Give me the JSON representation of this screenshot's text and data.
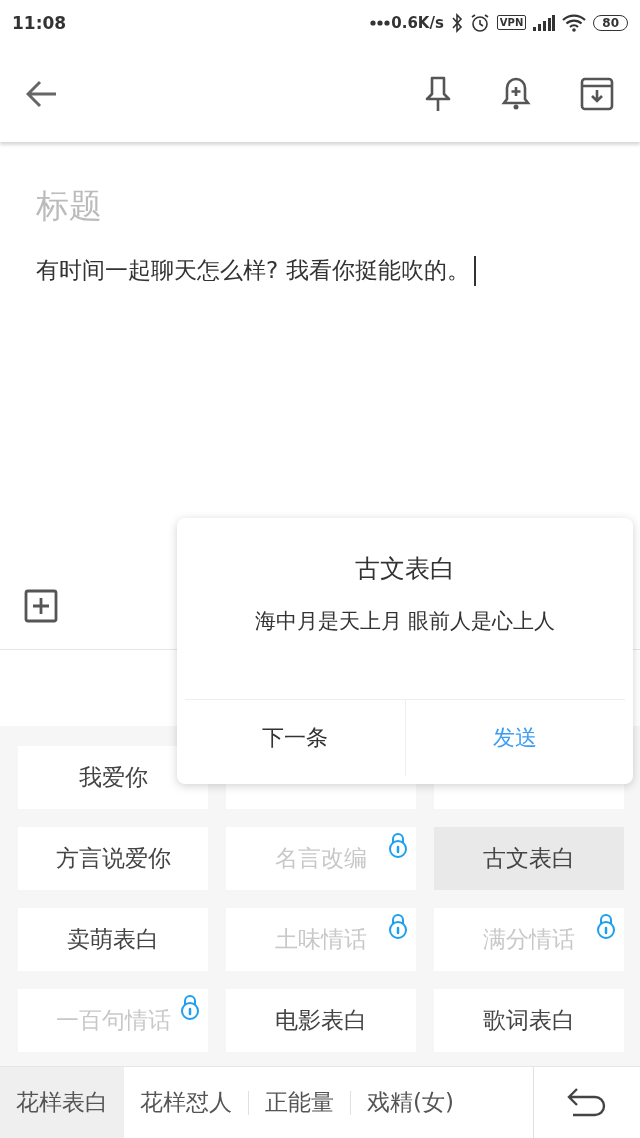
{
  "status_bar": {
    "time": "11:08",
    "speed": "0.6K/s",
    "vpn": "VPN",
    "battery": "80"
  },
  "editor": {
    "title_placeholder": "标题",
    "body": "有时间一起聊天怎么样? 我看你挺能吹的。"
  },
  "keyboard": {
    "cells": [
      {
        "label": "我爱你",
        "locked": false,
        "selected": false
      },
      {},
      {},
      {
        "label": "方言说爱你",
        "locked": false,
        "selected": false
      },
      {
        "label": "名言改编",
        "locked": true,
        "selected": false
      },
      {
        "label": "古文表白",
        "locked": false,
        "selected": true
      },
      {
        "label": "卖萌表白",
        "locked": false,
        "selected": false
      },
      {
        "label": "土味情话",
        "locked": true,
        "selected": false
      },
      {
        "label": "满分情话",
        "locked": true,
        "selected": false
      },
      {
        "label": "一百句情话",
        "locked": true,
        "selected": false
      },
      {
        "label": "电影表白",
        "locked": false,
        "selected": false
      },
      {
        "label": "歌词表白",
        "locked": false,
        "selected": false
      }
    ],
    "tabs": [
      {
        "label": "花样表白",
        "selected": true
      },
      {
        "label": "花样怼人",
        "selected": false
      },
      {
        "label": "正能量",
        "selected": false
      },
      {
        "label": "戏精(女)",
        "selected": false
      }
    ]
  },
  "popup": {
    "title": "古文表白",
    "text": "海中月是天上月 眼前人是心上人",
    "buttons": [
      {
        "label": "下一条",
        "kind": "plain"
      },
      {
        "label": "发送",
        "kind": "primary"
      }
    ]
  }
}
